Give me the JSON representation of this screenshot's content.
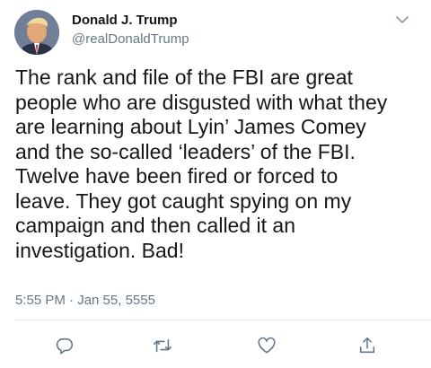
{
  "tweet": {
    "display_name": "Donald J. Trump",
    "handle": "@realDonaldTrump",
    "text": "The rank and file of the FBI are great\npeople who are disgusted with what they\nare learning about Lyin’ James Comey\nand the so-called ‘leaders’ of the FBI.\nTwelve have been fired or forced to\nleave. They got caught spying on my\ncampaign and then called it an\ninvestigation. Bad!",
    "timestamp": "5:55 PM · Jan 55, 5555"
  },
  "icons": {
    "menu": "chevron-down-icon",
    "reply": "reply-icon",
    "retweet": "retweet-icon",
    "like": "heart-icon",
    "share": "share-icon"
  },
  "colors": {
    "text": "#14171a",
    "secondary": "#657786",
    "icon": "#657786",
    "divider": "#e6ecf0"
  }
}
